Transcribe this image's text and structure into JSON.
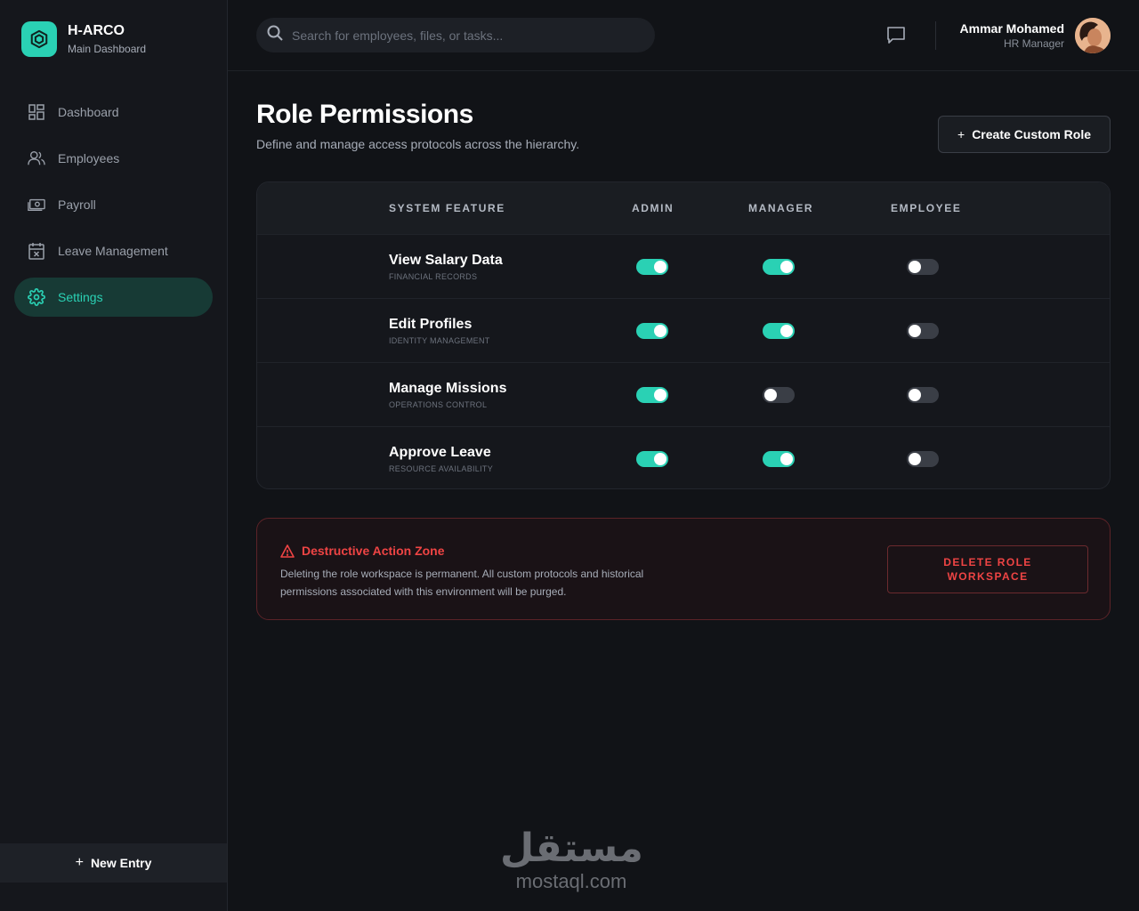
{
  "brand": {
    "name": "H-ARCO",
    "subtitle": "Main Dashboard"
  },
  "sidebar": {
    "items": [
      {
        "label": "Dashboard",
        "icon": "grid-icon",
        "active": false
      },
      {
        "label": "Employees",
        "icon": "users-icon",
        "active": false
      },
      {
        "label": "Payroll",
        "icon": "money-icon",
        "active": false
      },
      {
        "label": "Leave Management",
        "icon": "calendar-x-icon",
        "active": false
      },
      {
        "label": "Settings",
        "icon": "gear-icon",
        "active": true
      }
    ],
    "new_entry_label": "New Entry"
  },
  "search": {
    "placeholder": "Search for employees, files, or tasks..."
  },
  "user": {
    "name": "Ammar Mohamed",
    "role": "HR Manager"
  },
  "page": {
    "title": "Role Permissions",
    "subtitle": "Define and manage access protocols across the hierarchy.",
    "create_role_label": "Create Custom Role"
  },
  "table": {
    "headers": {
      "feature": "SYSTEM FEATURE",
      "admin": "ADMIN",
      "manager": "MANAGER",
      "employee": "EMPLOYEE"
    },
    "rows": [
      {
        "name": "View Salary Data",
        "category": "FINANCIAL RECORDS",
        "admin": true,
        "manager": true,
        "employee": false
      },
      {
        "name": "Edit Profiles",
        "category": "IDENTITY MANAGEMENT",
        "admin": true,
        "manager": true,
        "employee": false
      },
      {
        "name": "Manage Missions",
        "category": "OPERATIONS CONTROL",
        "admin": true,
        "manager": false,
        "employee": false
      },
      {
        "name": "Approve Leave",
        "category": "RESOURCE AVAILABILITY",
        "admin": true,
        "manager": true,
        "employee": false
      }
    ]
  },
  "danger": {
    "title": "Destructive Action Zone",
    "description": "Deleting the role workspace is permanent. All custom protocols and historical permissions associated with this environment will be purged.",
    "button_line1": "DELETE ROLE",
    "button_line2": "WORKSPACE"
  },
  "watermark": {
    "arabic": "مستقل",
    "latin": "mostaql.com"
  },
  "colors": {
    "accent": "#2ad1b4",
    "danger": "#ef4444",
    "background": "#111317"
  }
}
